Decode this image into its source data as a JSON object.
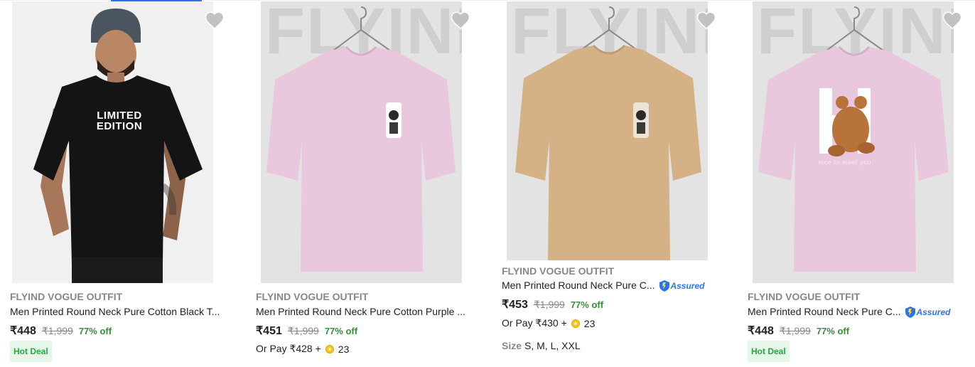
{
  "colors": {
    "discount": "#388e3c",
    "accent": "#2874f0",
    "hot_deal_bg": "#e6f7ea"
  },
  "products": [
    {
      "watermark": "",
      "print_text": "LIMITED EDITION",
      "brand": "FLYIND VOGUE OUTFIT",
      "title": "Men Printed Round Neck Pure Cotton Black T...",
      "price": "₹448",
      "mrp": "₹1,999",
      "discount": "77% off",
      "badge": "Hot Deal",
      "wishlist_icon": "heart-icon"
    },
    {
      "watermark": "FLYIND",
      "brand": "FLYIND VOGUE OUTFIT",
      "title": "Men Printed Round Neck Pure Cotton Purple ...",
      "price": "₹451",
      "mrp": "₹1,999",
      "discount": "77% off",
      "pay_prefix": "Or Pay ₹428 +",
      "coins": "23",
      "wishlist_icon": "heart-icon"
    },
    {
      "watermark": "FLYIND",
      "brand": "FLYIND VOGUE OUTFIT",
      "title": "Men Printed Round Neck Pure C...",
      "assured": "Assured",
      "price": "₹453",
      "mrp": "₹1,999",
      "discount": "77% off",
      "pay_prefix": "Or Pay ₹430 +",
      "coins": "23",
      "size_label": "Size",
      "sizes": "S, M, L, XXL",
      "wishlist_icon": "heart-icon"
    },
    {
      "watermark": "FLYIND",
      "print_text": "nice to meet you",
      "brand": "FLYIND VOGUE OUTFIT",
      "title": "Men Printed Round Neck Pure C...",
      "assured": "Assured",
      "price": "₹448",
      "mrp": "₹1,999",
      "discount": "77% off",
      "badge": "Hot Deal",
      "wishlist_icon": "heart-icon"
    }
  ]
}
